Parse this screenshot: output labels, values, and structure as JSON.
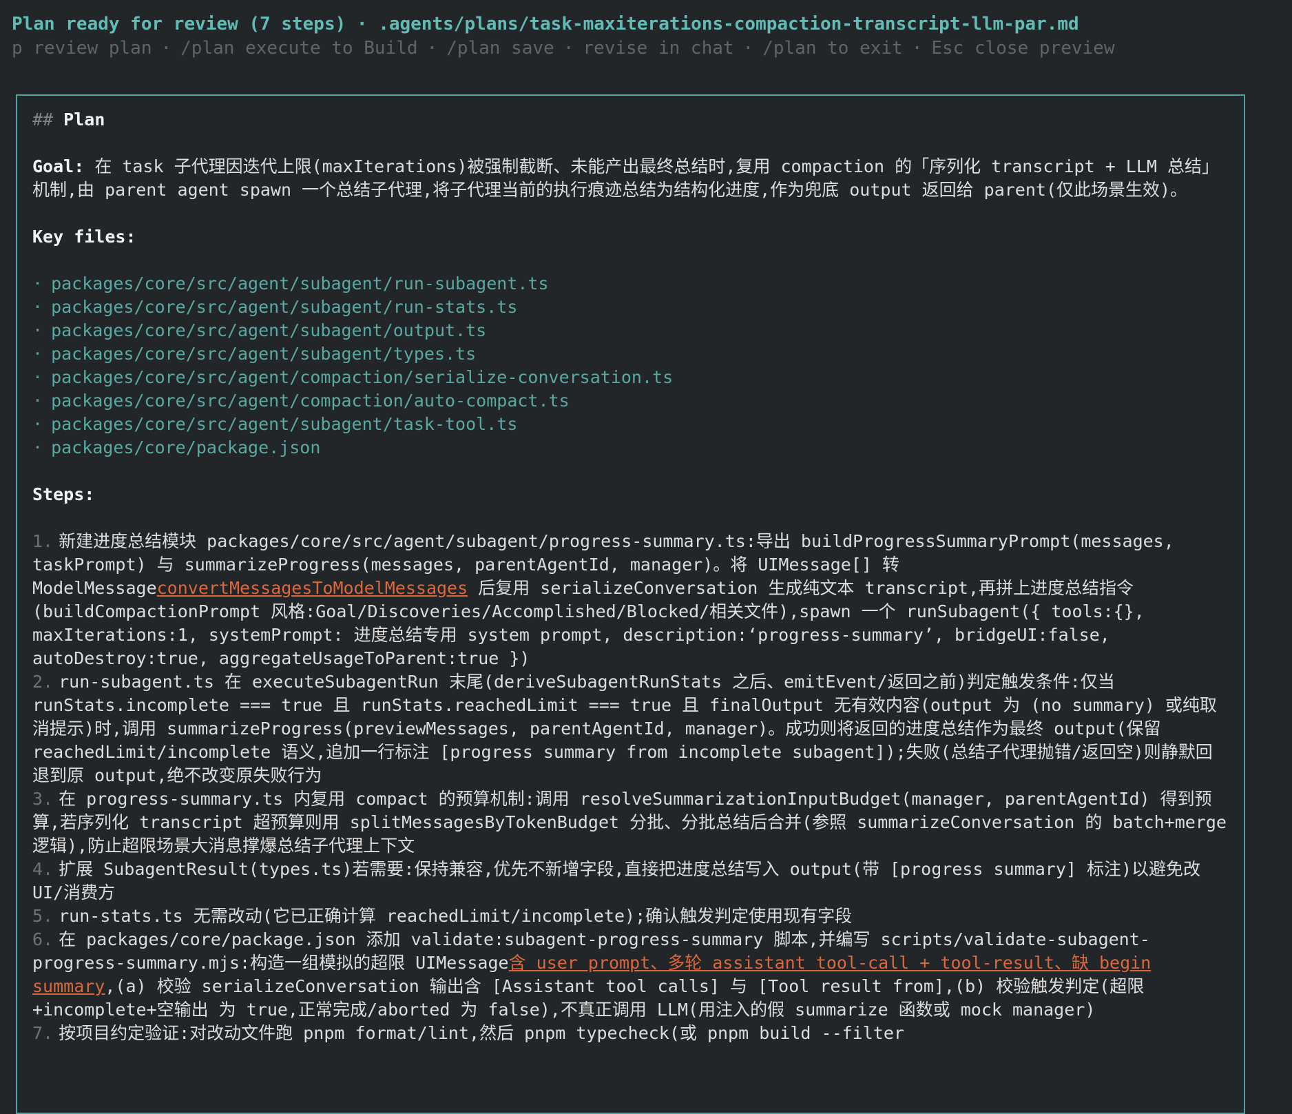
{
  "header": {
    "title": "Plan ready for review (7 steps) · .agents/plans/task-maxiterations-compaction-transcript-llm-par.md",
    "hints": [
      "p review plan",
      "/plan execute to Build",
      "/plan save",
      "revise in chat",
      "/plan to exit",
      "Esc close preview"
    ],
    "hint_separator": "·"
  },
  "plan": {
    "heading_prefix": "##",
    "heading": "Plan",
    "goal_label": "Goal:",
    "goal_text": "在 task 子代理因迭代上限(maxIterations)被强制截断、未能产出最终总结时,复用 compaction 的「序列化 transcript + LLM 总结」机制,由 parent agent spawn 一个总结子代理,将子代理当前的执行痕迹总结为结构化进度,作为兜底 output 返回给 parent(仅此场景生效)。",
    "key_files_label": "Key files:",
    "key_files": [
      "packages/core/src/agent/subagent/run-subagent.ts",
      "packages/core/src/agent/subagent/run-stats.ts",
      "packages/core/src/agent/subagent/output.ts",
      "packages/core/src/agent/subagent/types.ts",
      "packages/core/src/agent/compaction/serialize-conversation.ts",
      "packages/core/src/agent/compaction/auto-compact.ts",
      "packages/core/src/agent/subagent/task-tool.ts",
      "packages/core/package.json"
    ],
    "bullet": "·",
    "steps_label": "Steps:",
    "steps": [
      {
        "num": "1.",
        "before": "新建进度总结模块 packages/core/src/agent/subagent/progress-summary.ts:导出 buildProgressSummaryPrompt(messages, taskPrompt) 与 summarizeProgress(messages, parentAgentId, manager)。将 UIMessage[] 转 ModelMessage",
        "link": "convertMessagesToModelMessages",
        "after": " 后复用 serializeConversation 生成纯文本 transcript,再拼上进度总结指令(buildCompactionPrompt 风格:Goal/Discoveries/Accomplished/Blocked/相关文件),spawn 一个 runSubagent({ tools:{}, maxIterations:1, systemPrompt: 进度总结专用 system prompt, description:‘progress-summary’, bridgeUI:false, autoDestroy:true, aggregateUsageToParent:true })"
      },
      {
        "num": "2.",
        "before": "run-subagent.ts 在 executeSubagentRun 末尾(deriveSubagentRunStats 之后、emitEvent/返回之前)判定触发条件:仅当 runStats.incomplete === true 且 runStats.reachedLimit === true 且 finalOutput 无有效内容(output 为 (no summary) 或纯取消提示)时,调用 summarizeProgress(previewMessages, parentAgentId, manager)。成功则将返回的进度总结作为最终 output(保留 reachedLimit/incomplete 语义,追加一行标注 [progress summary from incomplete subagent]);失败(总结子代理抛错/返回空)则静默回退到原 output,绝不改变原失败行为",
        "link": "",
        "after": ""
      },
      {
        "num": "3.",
        "before": "在 progress-summary.ts 内复用 compact 的预算机制:调用 resolveSummarizationInputBudget(manager, parentAgentId) 得到预算,若序列化 transcript 超预算则用 splitMessagesByTokenBudget 分批、分批总结后合并(参照 summarizeConversation 的 batch+merge 逻辑),防止超限场景大消息撑爆总结子代理上下文",
        "link": "",
        "after": ""
      },
      {
        "num": "4.",
        "before": "扩展 SubagentResult(types.ts)若需要:保持兼容,优先不新增字段,直接把进度总结写入 output(带 [progress summary] 标注)以避免改 UI/消费方",
        "link": "",
        "after": ""
      },
      {
        "num": "5.",
        "before": "run-stats.ts 无需改动(它已正确计算 reachedLimit/incomplete);确认触发判定使用现有字段",
        "link": "",
        "after": ""
      },
      {
        "num": "6.",
        "before": "在 packages/core/package.json 添加 validate:subagent-progress-summary 脚本,并编写 scripts/validate-subagent-progress-summary.mjs:构造一组模拟的超限 UIMessage",
        "link": "含 user prompt、多轮 assistant tool-call + tool-result、缺 begin summary",
        "after": ",(a) 校验 serializeConversation 输出含 [Assistant tool calls] 与 [Tool result from],(b) 校验触发判定(超限+incomplete+空输出 为 true,正常完成/aborted 为 false),不真正调用 LLM(用注入的假 summarize 函数或 mock manager)"
      },
      {
        "num": "7.",
        "before": "按项目约定验证:对改动文件跑 pnpm format/lint,然后 pnpm typecheck(或 pnpm build --filter",
        "link": "",
        "after": ""
      }
    ]
  }
}
